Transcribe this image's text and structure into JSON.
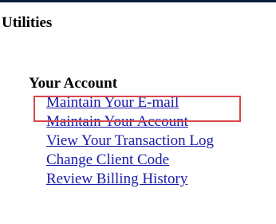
{
  "page": {
    "section_title": "Utilities"
  },
  "account": {
    "heading": "Your Account",
    "links": [
      {
        "label": "Maintain Your E-mail",
        "highlighted": true
      },
      {
        "label": "Maintain Your Account",
        "highlighted": false
      },
      {
        "label": "View Your Transaction Log",
        "highlighted": false
      },
      {
        "label": "Change Client Code",
        "highlighted": false
      },
      {
        "label": "Review Billing History",
        "highlighted": false
      }
    ]
  },
  "colors": {
    "link": "#1a1aa8",
    "top_rule": "#0a1d3f",
    "highlight_border": "#d9464a"
  }
}
